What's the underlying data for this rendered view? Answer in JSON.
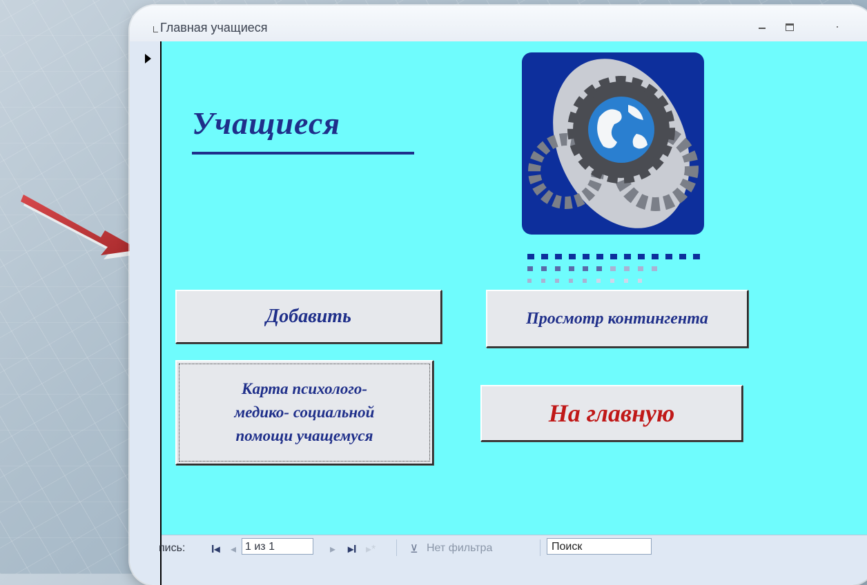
{
  "window": {
    "title": "Главная учащиеся"
  },
  "form": {
    "heading": "Учащиеся",
    "buttons": {
      "add": "Добавить",
      "view_contingent": "Просмотр контингента",
      "card_line1": "Карта психолого-",
      "card_line2": "медико- социальной",
      "card_line3": "помощи учащемуся",
      "home": "На главную"
    }
  },
  "statusbar": {
    "record_label": "пись:",
    "record_position": "1 из 1",
    "filter_label": "Нет фильтра",
    "search_value": "Поиск"
  },
  "icons": {
    "logo": "gears-globe-logo",
    "arrow": "red-pointer-arrow"
  },
  "colors": {
    "form_background": "#6ffcfd",
    "heading": "#1f2f8a",
    "home_button_text": "#c01818",
    "arrow": "#c0393b"
  }
}
